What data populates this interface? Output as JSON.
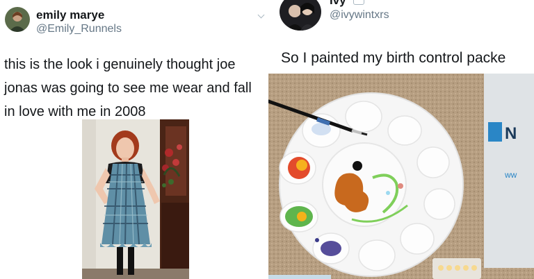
{
  "left_tweet": {
    "display_name": "emily marye",
    "handle": "@Emily_Runnels",
    "text_lines": [
      "this is the look i genuinely thought joe",
      "jonas was going to see me wear and fall",
      "in love with me in 2008"
    ],
    "icons": {
      "avatar": "avatar-photo",
      "menu": "chevron-down-icon"
    }
  },
  "right_tweet": {
    "display_name": "Ivy",
    "handle": "@ivywintxrs",
    "text": "So I painted my birth control packe",
    "icons": {
      "avatar": "avatar-photo",
      "badge": "heart-emoji-icon"
    }
  },
  "colors": {
    "text_primary": "#14171a",
    "text_secondary": "#657786",
    "background": "#ffffff"
  }
}
